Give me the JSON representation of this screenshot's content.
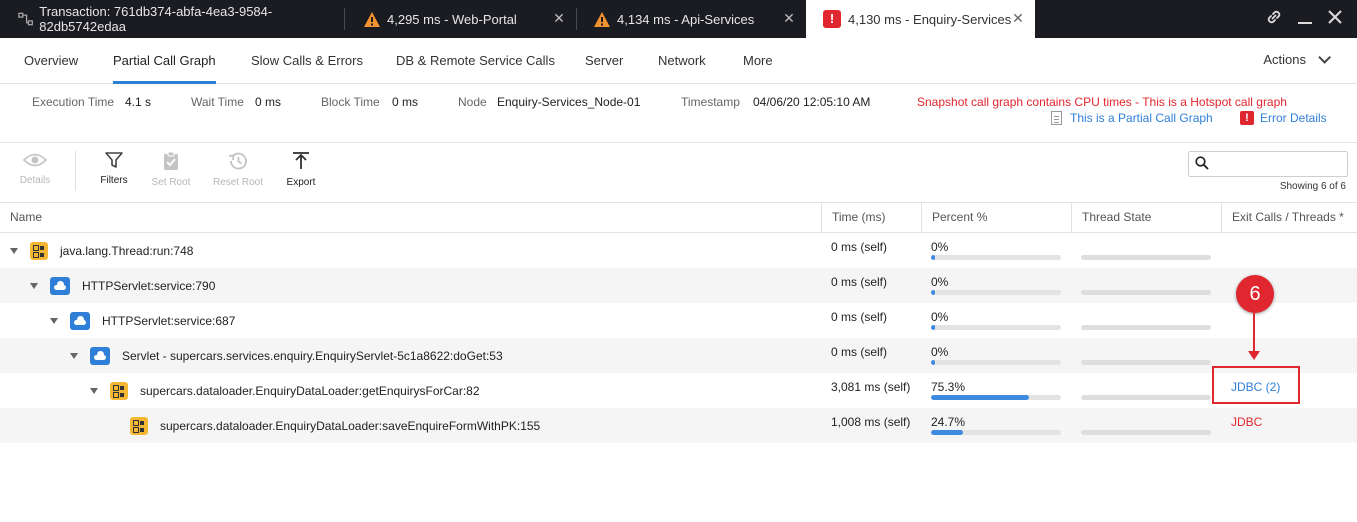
{
  "tabs": [
    {
      "label": "Transaction: 761db374-abfa-4ea3-9584-82db5742edaa",
      "icon": "transaction-icon",
      "active": false
    },
    {
      "label": "4,295 ms - Web-Portal",
      "icon": "warning-icon",
      "active": false
    },
    {
      "label": "4,134 ms - Api-Services",
      "icon": "warning-icon",
      "active": false
    },
    {
      "label": "4,130 ms - Enquiry-Services",
      "icon": "error-icon",
      "active": true
    }
  ],
  "window_controls": {
    "link": "link-icon",
    "minimize": "minimize-icon",
    "close": "close-icon"
  },
  "nav": {
    "items": [
      "Overview",
      "Partial Call Graph",
      "Slow Calls & Errors",
      "DB & Remote Service Calls",
      "Server",
      "Network",
      "More"
    ],
    "active": "Partial Call Graph",
    "actions_label": "Actions"
  },
  "info": {
    "execution_time_label": "Execution Time",
    "execution_time": "4.1 s",
    "wait_time_label": "Wait Time",
    "wait_time": "0 ms",
    "block_time_label": "Block Time",
    "block_time": "0 ms",
    "node_label": "Node",
    "node": "Enquiry-Services_Node-01",
    "timestamp_label": "Timestamp",
    "timestamp": "04/06/20 12:05:10 AM",
    "warning": "Snapshot call graph contains CPU times - This is a Hotspot call graph",
    "partial_link": "This is a Partial Call Graph",
    "error_link": "Error Details"
  },
  "toolbar": {
    "details": "Details",
    "filters": "Filters",
    "set_root": "Set Root",
    "reset_root": "Reset Root",
    "export": "Export",
    "search_placeholder": "",
    "showing": "Showing 6 of 6"
  },
  "table": {
    "headers": {
      "name": "Name",
      "time": "Time (ms)",
      "percent": "Percent %",
      "thread_state": "Thread State",
      "exit_calls": "Exit Calls / Threads *"
    },
    "rows": [
      {
        "name": "java.lang.Thread:run:748",
        "icon": "pojo-icon",
        "time": "0 ms (self)",
        "percent": "0%",
        "percent_value": 0,
        "exit": "",
        "exit_color": ""
      },
      {
        "name": "HTTPServlet:service:790",
        "icon": "cloud-icon",
        "time": "0 ms (self)",
        "percent": "0%",
        "percent_value": 0,
        "exit": "",
        "exit_color": ""
      },
      {
        "name": "HTTPServlet:service:687",
        "icon": "cloud-icon",
        "time": "0 ms (self)",
        "percent": "0%",
        "percent_value": 0,
        "exit": "",
        "exit_color": ""
      },
      {
        "name": "Servlet - supercars.services.enquiry.EnquiryServlet-5c1a8622:doGet:53",
        "icon": "cloud-icon",
        "time": "0 ms (self)",
        "percent": "0%",
        "percent_value": 0,
        "exit": "",
        "exit_color": ""
      },
      {
        "name": "supercars.dataloader.EnquiryDataLoader:getEnquirysForCar:82",
        "icon": "pojo-icon",
        "time": "3,081 ms (self)",
        "percent": "75.3%",
        "percent_value": 75.3,
        "exit": "JDBC (2)",
        "exit_color": "blue"
      },
      {
        "name": "supercars.dataloader.EnquiryDataLoader:saveEnquireFormWithPK:155",
        "icon": "pojo-icon",
        "time": "1,008 ms (self)",
        "percent": "24.7%",
        "percent_value": 24.7,
        "exit": "JDBC",
        "exit_color": "red"
      }
    ]
  },
  "annotation": {
    "number": "6"
  }
}
